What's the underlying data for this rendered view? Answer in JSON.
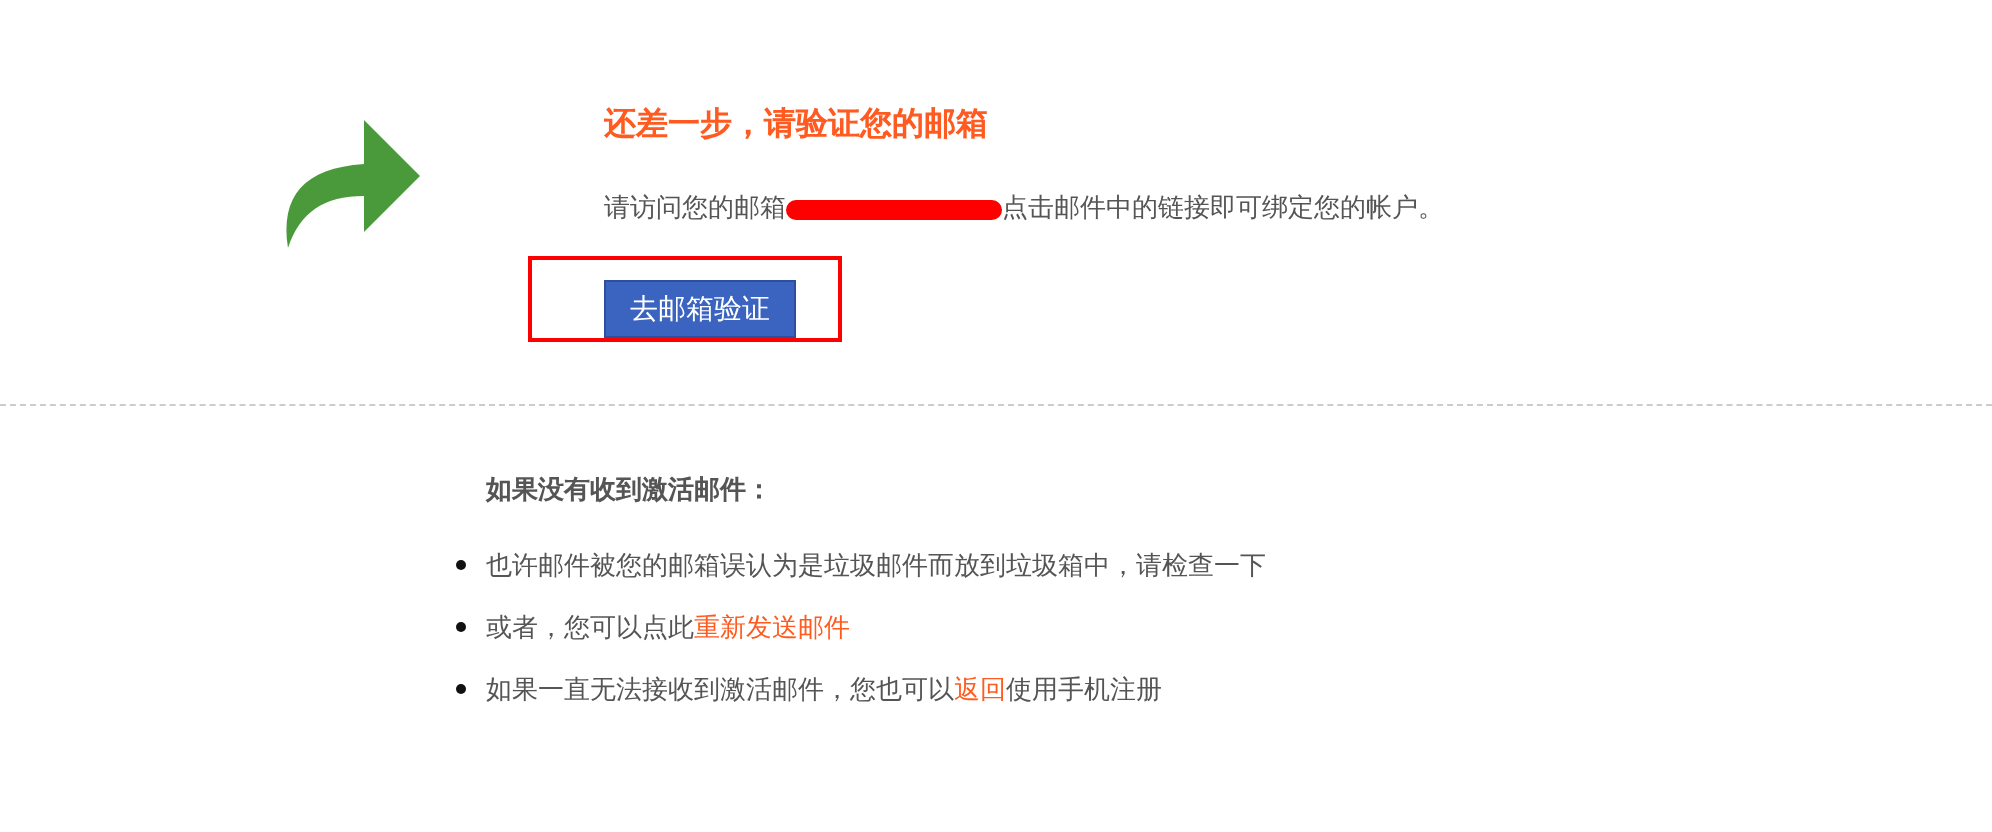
{
  "title": "还差一步，请验证您的邮箱",
  "instruction": {
    "before": "请访问您的邮箱",
    "email_redacted": true,
    "after": "点击邮件中的链接即可绑定您的帐户。"
  },
  "verify_button": {
    "label": "去邮箱验证",
    "highlighted": true
  },
  "help": {
    "heading": "如果没有收到激活邮件：",
    "tips": [
      {
        "parts": [
          {
            "text": "也许邮件被您的邮箱误认为是垃圾邮件而放到垃圾箱中，请检查一下",
            "link": false
          }
        ]
      },
      {
        "parts": [
          {
            "text": "或者，您可以点此",
            "link": false
          },
          {
            "text": "重新发送邮件",
            "link": true
          }
        ]
      },
      {
        "parts": [
          {
            "text": "如果一直无法接收到激活邮件，您也可以",
            "link": false
          },
          {
            "text": "返回",
            "link": true
          },
          {
            "text": "使用手机注册",
            "link": false
          }
        ]
      }
    ]
  }
}
